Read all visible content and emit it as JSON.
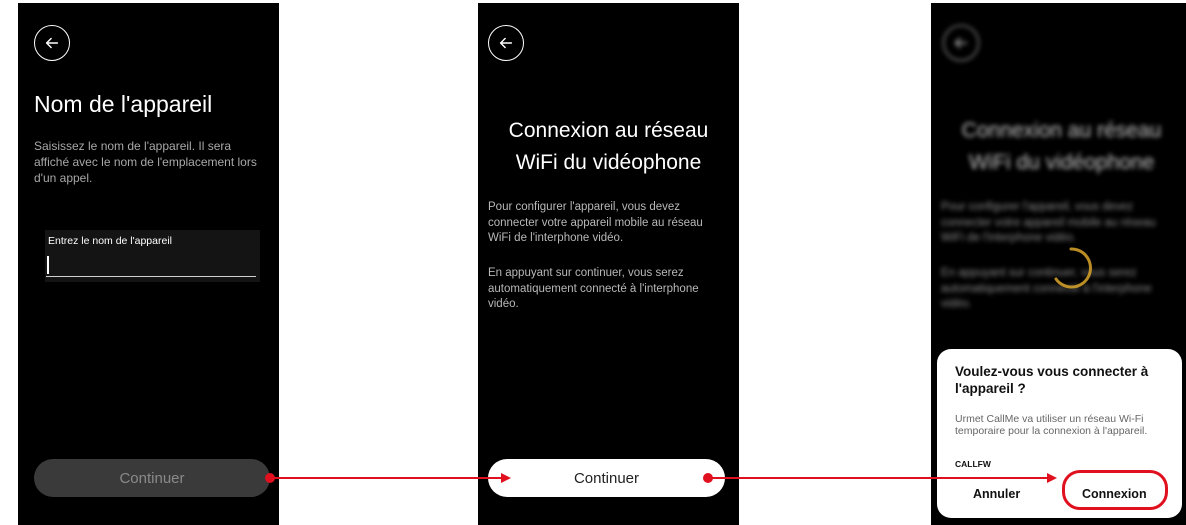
{
  "screen1": {
    "back_icon": "arrow-left-icon",
    "title": "Nom de l'appareil",
    "subtitle": "Saisissez le nom de l'appareil. Il sera affiché avec le nom de l'emplacement lors d'un appel.",
    "field_label": "Entrez le nom de l'appareil",
    "field_value": "",
    "continue_label": "Continuer"
  },
  "screen2": {
    "back_icon": "arrow-left-icon",
    "title_line1": "Connexion au réseau",
    "title_line2": "WiFi du vidéophone",
    "para1": "Pour configurer l'appareil, vous devez connecter votre appareil mobile au réseau WiFi de l'interphone vidéo.",
    "para2": "En appuyant sur continuer, vous serez automatiquement connecté à l'interphone vidéo.",
    "continue_label": "Continuer"
  },
  "screen3": {
    "back_icon": "arrow-left-icon",
    "title_line1": "Connexion au réseau",
    "title_line2": "WiFi du vidéophone",
    "para1": "Pour configurer l'appareil, vous devez connecter votre appareil mobile au réseau WiFi de l'interphone vidéo.",
    "para2": "En appuyant sur continuer, vous serez automatiquement connecté à l'interphone vidéo.",
    "spinner_icon": "loading-spinner-icon",
    "dialog": {
      "title": "Voulez-vous vous connecter à l'appareil ?",
      "body": "Urmet CallMe va utiliser un réseau Wi-Fi temporaire pour la connexion à l'appareil.",
      "ssid": "CALLFW",
      "cancel_label": "Annuler",
      "connect_label": "Connexion"
    }
  },
  "colors": {
    "accent_red": "#e0101f",
    "spinner_gold": "#d9a42a",
    "screen_bg": "#000000"
  }
}
